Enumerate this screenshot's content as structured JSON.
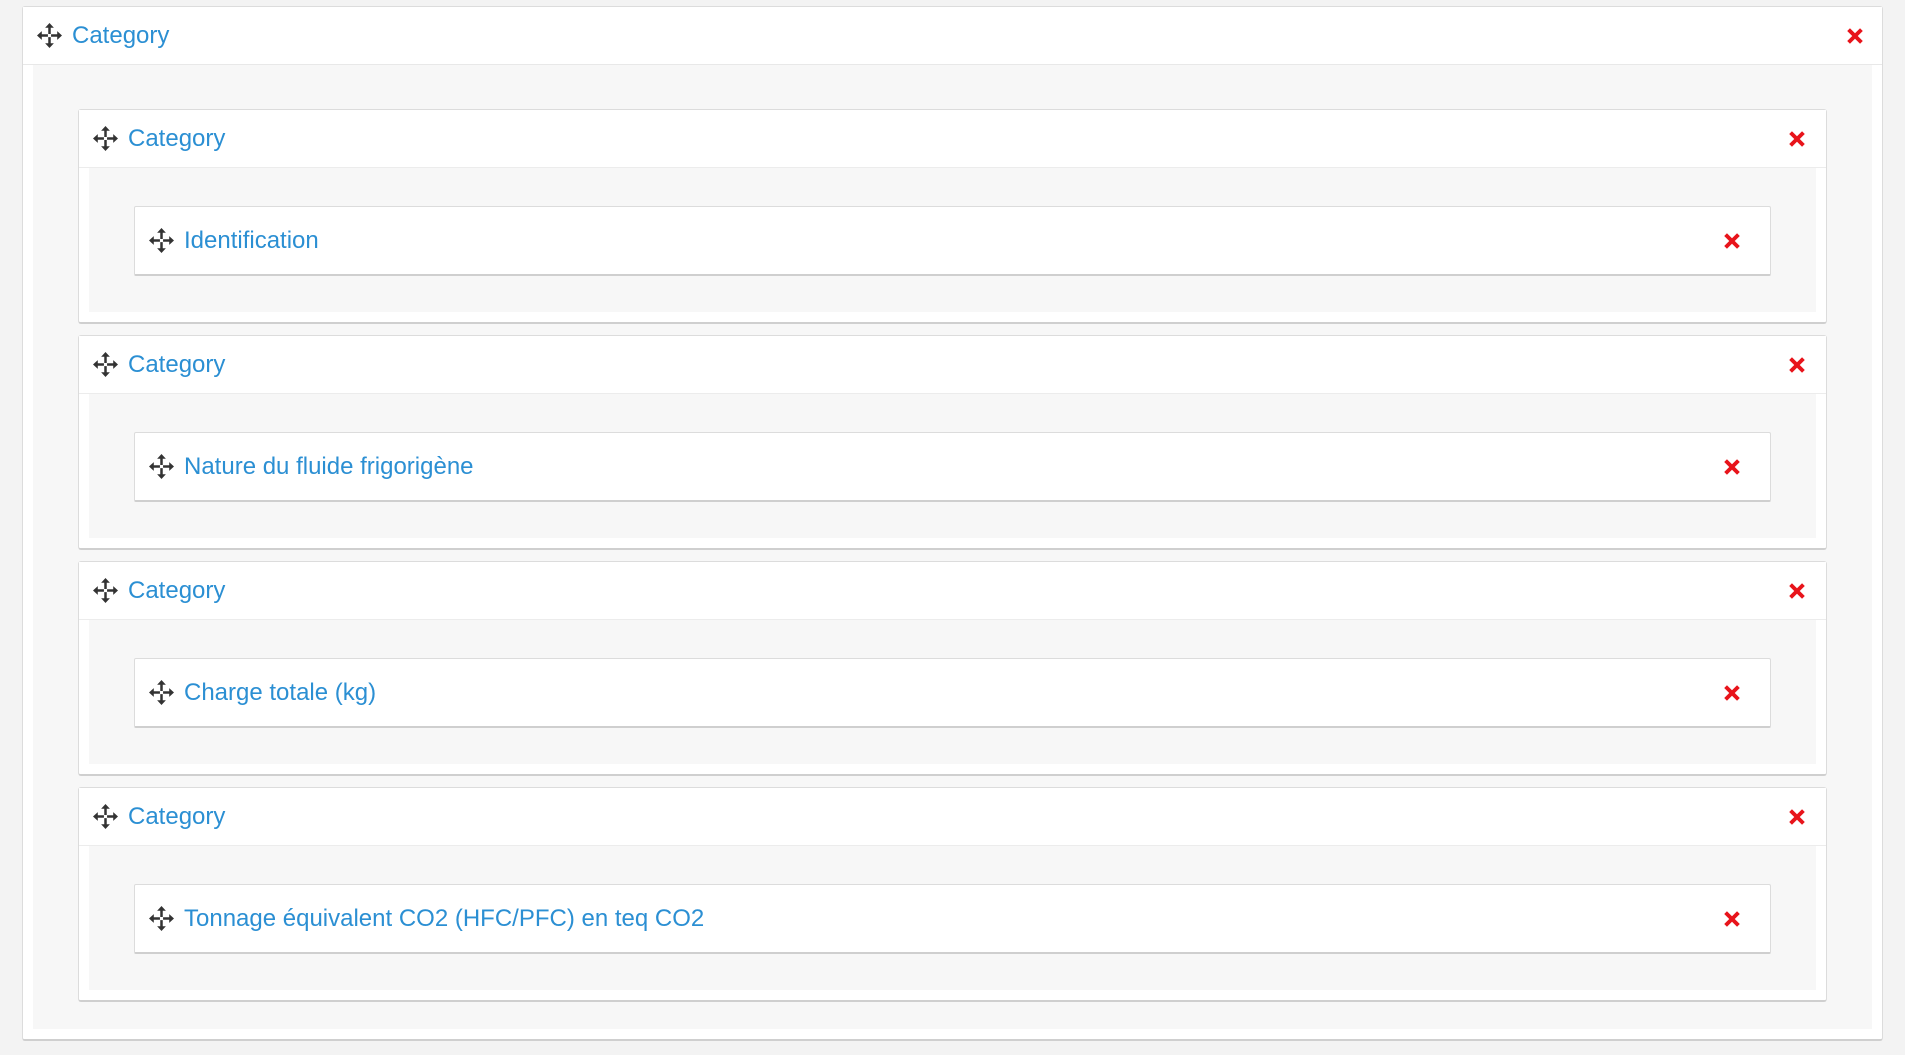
{
  "root": {
    "title": "Category",
    "move_icon": "move-arrows-icon",
    "close_icon": "close-x-icon"
  },
  "categories": [
    {
      "title": "Category",
      "fields": [
        {
          "label": "Identification"
        }
      ]
    },
    {
      "title": "Category",
      "fields": [
        {
          "label": "Nature du fluide frigorigène"
        }
      ]
    },
    {
      "title": "Category",
      "fields": [
        {
          "label": "Charge totale (kg)"
        }
      ]
    },
    {
      "title": "Category",
      "fields": [
        {
          "label": "Tonnage équivalent CO2 (HFC/PFC) en teq CO2"
        }
      ]
    }
  ],
  "colors": {
    "link_blue": "#2b8fd3",
    "close_red": "#e8141b",
    "icon_dark": "#333333"
  }
}
